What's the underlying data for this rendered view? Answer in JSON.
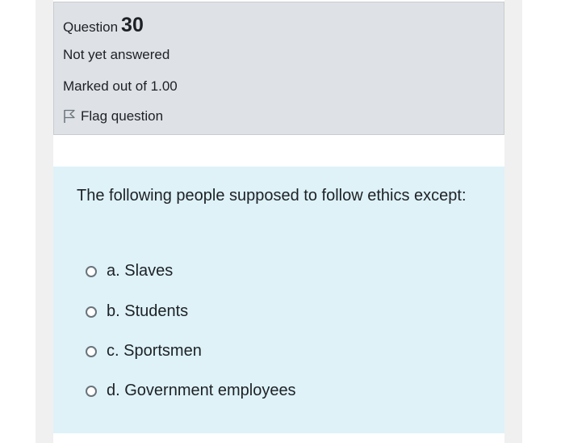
{
  "question": {
    "label": "Question",
    "number": "30",
    "state": "Not yet answered",
    "grade": "Marked out of 1.00",
    "flag_label": "Flag question",
    "flag_icon": "flag-icon"
  },
  "content": {
    "text": "The following people supposed to follow ethics except:",
    "options": [
      {
        "label": "a. Slaves"
      },
      {
        "label": "b. Students"
      },
      {
        "label": "c. Sportsmen"
      },
      {
        "label": "d. Government employees"
      }
    ]
  },
  "colors": {
    "info_background": "#dee2e6",
    "content_background": "#def2f8",
    "text": "#1d2125"
  }
}
